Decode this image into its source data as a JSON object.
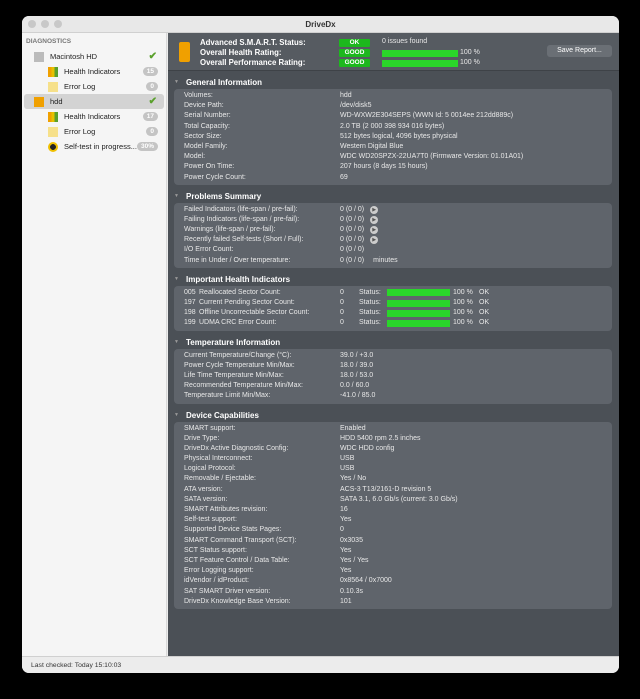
{
  "window": {
    "title": "DriveDx"
  },
  "sidebar": {
    "heading": "DIAGNOSTICS",
    "items": [
      {
        "label": "Macintosh HD",
        "type": "disk",
        "check": true
      },
      {
        "label": "Health Indicators",
        "type": "health",
        "badge": "15"
      },
      {
        "label": "Error Log",
        "type": "log",
        "badge": "0"
      },
      {
        "label": "hdd",
        "type": "disk-hdd",
        "check": true,
        "selected": true
      },
      {
        "label": "Health Indicators",
        "type": "health",
        "badge": "17"
      },
      {
        "label": "Error Log",
        "type": "log",
        "badge": "0"
      },
      {
        "label": "Self-test in progress...",
        "type": "selftest",
        "badge": "30%"
      }
    ]
  },
  "header": {
    "smart_label": "Advanced S.M.A.R.T. Status:",
    "smart_status": "OK",
    "smart_text": "0 issues found",
    "health_label": "Overall Health Rating:",
    "health_status": "GOOD",
    "health_pct": "100 %",
    "health_value": 100,
    "perf_label": "Overall Performance Rating:",
    "perf_status": "GOOD",
    "perf_pct": "100 %",
    "perf_value": 100,
    "save_button": "Save Report..."
  },
  "general": {
    "title": "General Information",
    "rows": [
      [
        "Volumes:",
        "hdd"
      ],
      [
        "Device Path:",
        "/dev/disk5"
      ],
      [
        "Serial Number:",
        "WD-WXW2E304SEPS (WWN Id: 5 0014ee 212dd889c)"
      ],
      [
        "Total Capacity:",
        "2.0 TB (2 000 398 934 016 bytes)"
      ],
      [
        "Sector Size:",
        "512 bytes logical, 4096 bytes physical"
      ],
      [
        "Model Family:",
        "Western Digital Blue"
      ],
      [
        "Model:",
        "WDC WD20SPZX-22UA7T0  (Firmware Version: 01.01A01)"
      ],
      [
        "Power On Time:",
        "207 hours (8 days 15 hours)"
      ],
      [
        "Power Cycle Count:",
        "69"
      ]
    ]
  },
  "problems": {
    "title": "Problems Summary",
    "rows": [
      [
        "Failed Indicators (life-span / pre-fail):",
        "0 (0 / 0)",
        "arrow"
      ],
      [
        "Failing Indicators (life-span / pre-fail):",
        "0 (0 / 0)",
        "arrow"
      ],
      [
        "Warnings (life-span / pre-fail):",
        "0 (0 / 0)",
        "arrow"
      ],
      [
        "Recently failed Self-tests (Short / Full):",
        "0 (0 / 0)",
        "arrow"
      ],
      [
        "I/O Error Count:",
        "0 (0 / 0)",
        ""
      ],
      [
        "Time in Under / Over temperature:",
        "0 (0 / 0)",
        "minutes"
      ]
    ]
  },
  "health": {
    "title": "Important Health Indicators",
    "status_label": "Status:",
    "rows": [
      [
        "005",
        "Reallocated Sector Count:",
        "0",
        "100 %",
        "OK",
        100
      ],
      [
        "197",
        "Current Pending Sector Count:",
        "0",
        "100 %",
        "OK",
        100
      ],
      [
        "198",
        "Offline Uncorrectable Sector Count:",
        "0",
        "100 %",
        "OK",
        100
      ],
      [
        "199",
        "UDMA CRC Error Count:",
        "0",
        "100 %",
        "OK",
        100
      ]
    ]
  },
  "temperature": {
    "title": "Temperature Information",
    "rows": [
      [
        "Current Temperature/Change (°C):",
        "39.0  / +3.0"
      ],
      [
        "Power Cycle Temperature Min/Max:",
        "18.0  / 39.0"
      ],
      [
        "Life Time Temperature Min/Max:",
        "18.0  / 53.0"
      ],
      [
        "Recommended Temperature Min/Max:",
        "0.0    / 60.0"
      ],
      [
        "Temperature Limit Min/Max:",
        "-41.0 / 85.0"
      ]
    ]
  },
  "capabilities": {
    "title": "Device Capabilities",
    "rows": [
      [
        "SMART support:",
        "Enabled"
      ],
      [
        "Drive Type:",
        "HDD 5400 rpm 2.5 inches"
      ],
      [
        "DriveDx Active Diagnostic Config:",
        "WDC HDD config"
      ],
      [
        "Physical Interconnect:",
        "USB"
      ],
      [
        "Logical Protocol:",
        "USB"
      ],
      [
        "Removable / Ejectable:",
        "Yes / No"
      ],
      [
        "ATA version:",
        "ACS-3 T13/2161-D revision 5"
      ],
      [
        "SATA version:",
        "SATA 3.1, 6.0 Gb/s (current: 3.0 Gb/s)"
      ],
      [
        "SMART Attributes revision:",
        "16"
      ],
      [
        "Self-test support:",
        "Yes"
      ],
      [
        "Supported Device Stats Pages:",
        "0"
      ],
      [
        "SMART Command Transport (SCT):",
        "0x3035"
      ],
      [
        "SCT Status support:",
        "Yes"
      ],
      [
        "SCT Feature Control / Data Table:",
        "Yes / Yes"
      ],
      [
        "Error Logging support:",
        "Yes"
      ],
      [
        "idVendor / idProduct:",
        "0x8564 / 0x7000"
      ],
      [
        "SAT SMART Driver version:",
        "0.10.3s"
      ],
      [
        "DriveDx Knowledge Base Version:",
        "101"
      ]
    ]
  },
  "footer": {
    "last_checked": "Last checked: Today 15:10:03"
  },
  "colors": {
    "good": "#1db81d",
    "bar": "#2ad62a",
    "drive": "#f0a000"
  }
}
